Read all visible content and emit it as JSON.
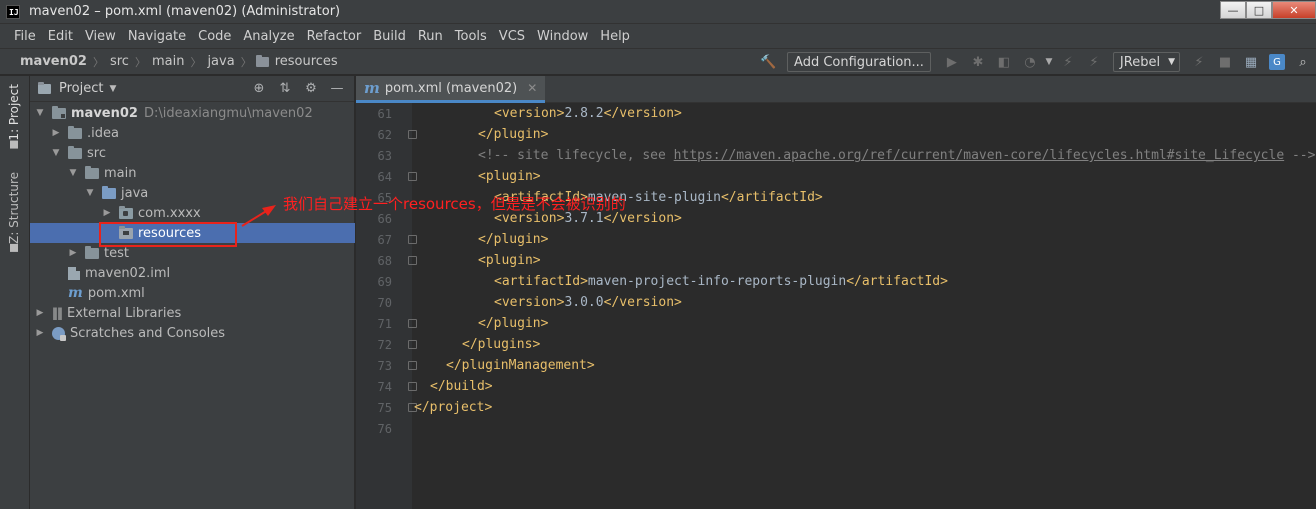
{
  "window": {
    "title": "maven02 – pom.xml (maven02) (Administrator)",
    "logo_text": "IJ",
    "controls": [
      "—",
      "□",
      "✕"
    ]
  },
  "menu": [
    "File",
    "Edit",
    "View",
    "Navigate",
    "Code",
    "Analyze",
    "Refactor",
    "Build",
    "Run",
    "Tools",
    "VCS",
    "Window",
    "Help"
  ],
  "breadcrumbs": [
    "maven02",
    "src",
    "main",
    "java",
    "resources"
  ],
  "toolbar": {
    "add_configuration_label": "Add Configuration...",
    "jrebel_label": "JRebel"
  },
  "tool_strip": {
    "project_tab": "1: Project",
    "structure_tab": "Z: Structure"
  },
  "project_panel": {
    "title": "Project",
    "tree": [
      {
        "label": "maven02",
        "path": "D:\\ideaxiangmu\\maven02"
      },
      {
        "label": ".idea"
      },
      {
        "label": "src"
      },
      {
        "label": "main"
      },
      {
        "label": "java"
      },
      {
        "label": "com.xxxx"
      },
      {
        "label": "resources"
      },
      {
        "label": "test"
      },
      {
        "label": "maven02.iml"
      },
      {
        "label": "pom.xml"
      },
      {
        "label": "External Libraries"
      },
      {
        "label": "Scratches and Consoles"
      }
    ]
  },
  "editor": {
    "tab_label": "pom.xml (maven02)",
    "lines": [
      {
        "num": "61",
        "parts": [
          {
            "t": "<version>",
            "c": "tag"
          },
          {
            "t": "2.8.2",
            "c": "txt"
          },
          {
            "t": "</version>",
            "c": "tag"
          }
        ]
      },
      {
        "num": "62",
        "parts": [
          {
            "t": "</plugin>",
            "c": "tag"
          }
        ]
      },
      {
        "num": "63",
        "parts": [
          {
            "t": "<!-- site lifecycle, see ",
            "c": "cmt"
          },
          {
            "t": "https://maven.apache.org/ref/current/maven-core/lifecycles.html#site_Lifecycle",
            "c": "url"
          },
          {
            "t": " -->",
            "c": "cmt"
          }
        ]
      },
      {
        "num": "64",
        "parts": [
          {
            "t": "<plugin>",
            "c": "tag"
          }
        ]
      },
      {
        "num": "65",
        "parts": [
          {
            "t": "<artifactId>",
            "c": "tag"
          },
          {
            "t": "maven-site-plugin",
            "c": "txt"
          },
          {
            "t": "</artifactId>",
            "c": "tag"
          }
        ]
      },
      {
        "num": "66",
        "parts": [
          {
            "t": "<version>",
            "c": "tag"
          },
          {
            "t": "3.7.1",
            "c": "txt"
          },
          {
            "t": "</version>",
            "c": "tag"
          }
        ]
      },
      {
        "num": "67",
        "parts": [
          {
            "t": "</plugin>",
            "c": "tag"
          }
        ]
      },
      {
        "num": "68",
        "parts": [
          {
            "t": "<plugin>",
            "c": "tag"
          }
        ]
      },
      {
        "num": "69",
        "parts": [
          {
            "t": "<artifactId>",
            "c": "tag"
          },
          {
            "t": "maven-project-info-reports-plugin",
            "c": "txt"
          },
          {
            "t": "</artifactId>",
            "c": "tag"
          }
        ]
      },
      {
        "num": "70",
        "parts": [
          {
            "t": "<version>",
            "c": "tag"
          },
          {
            "t": "3.0.0",
            "c": "txt"
          },
          {
            "t": "</version>",
            "c": "tag"
          }
        ]
      },
      {
        "num": "71",
        "parts": [
          {
            "t": "</plugin>",
            "c": "tag"
          }
        ]
      },
      {
        "num": "72",
        "parts": [
          {
            "t": "</plugins>",
            "c": "tag"
          }
        ]
      },
      {
        "num": "73",
        "parts": [
          {
            "t": "</pluginManagement>",
            "c": "tag"
          }
        ]
      },
      {
        "num": "74",
        "parts": [
          {
            "t": "</build>",
            "c": "tag"
          }
        ]
      },
      {
        "num": "75",
        "parts": [
          {
            "t": "</project>",
            "c": "tag"
          }
        ]
      },
      {
        "num": "76",
        "parts": []
      }
    ]
  },
  "annotation": {
    "text": "我们自己建立一个resources，但是是不会被识别的",
    "color": "#ff2020"
  },
  "colors": {
    "background": "#2b2b2b",
    "panel": "#3c3f41",
    "selection": "#4b6eaf",
    "xml_tag": "#e8bf6a",
    "xml_text": "#a9b7c6"
  }
}
